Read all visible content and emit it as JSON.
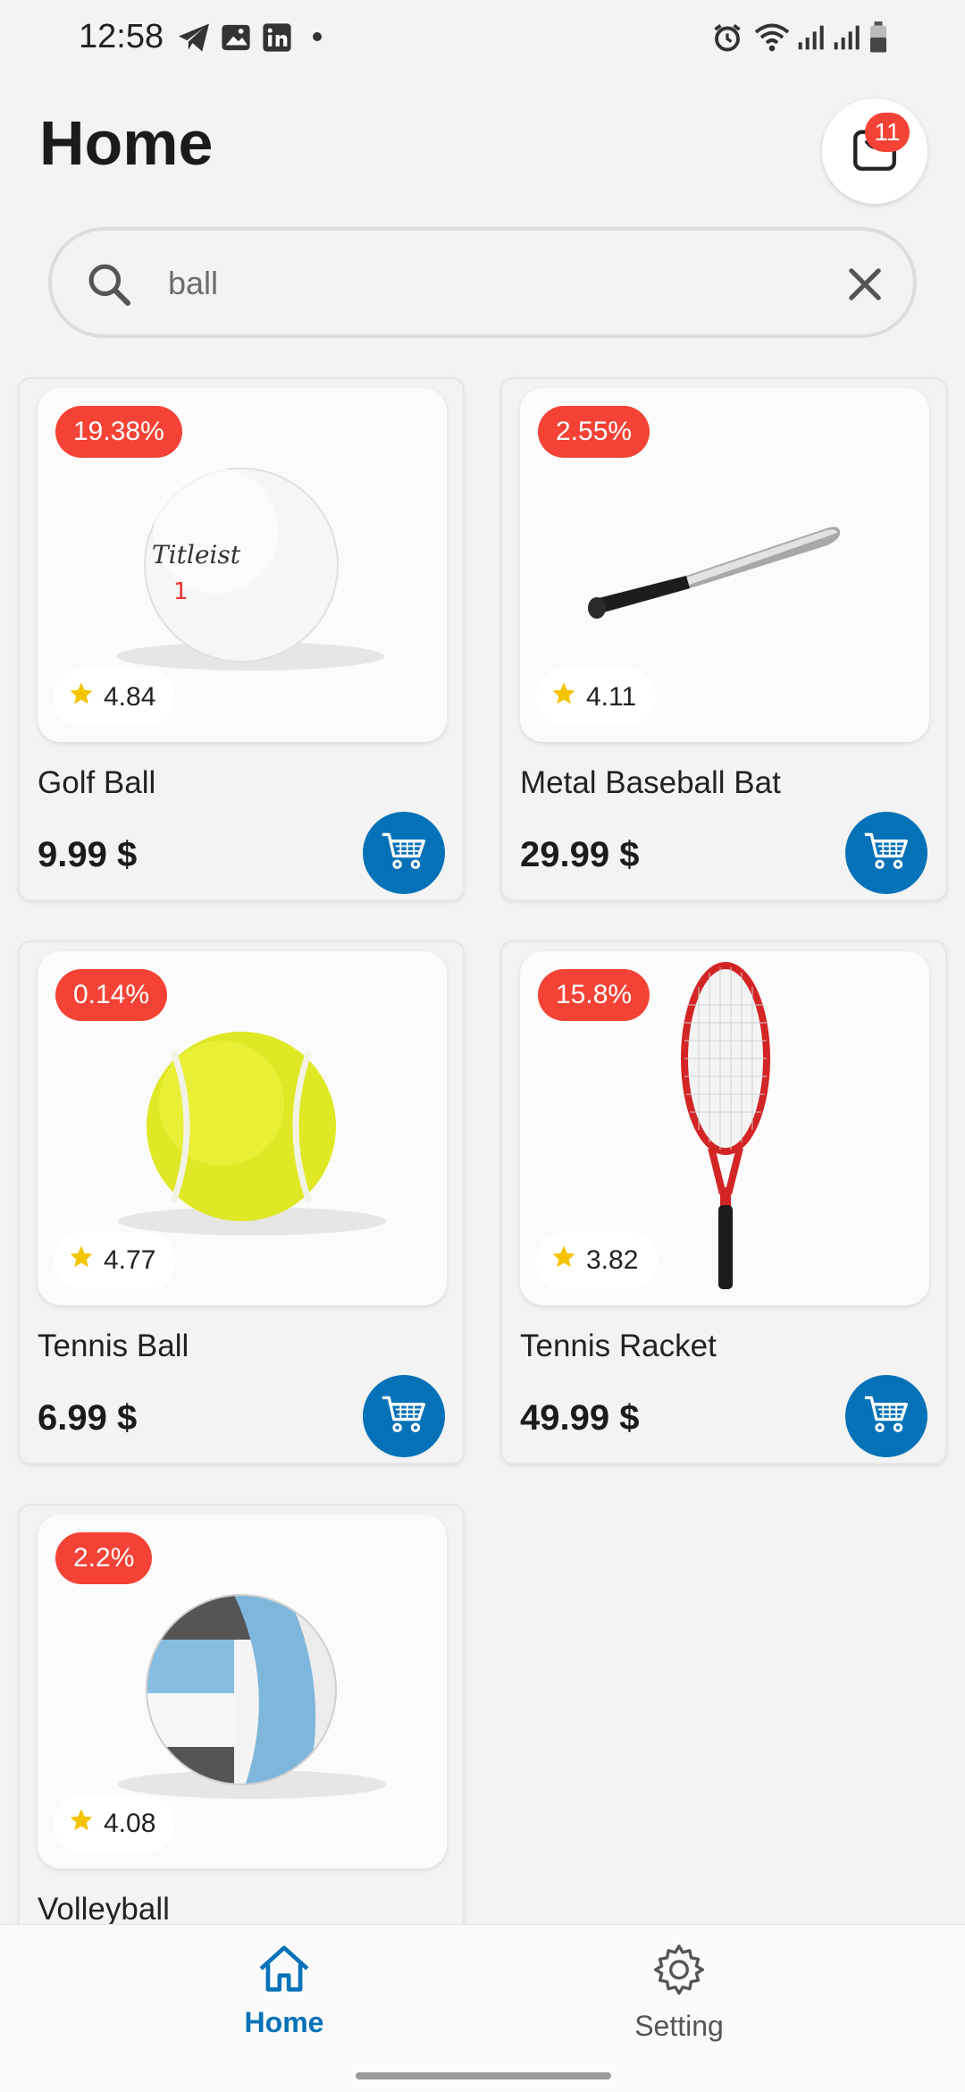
{
  "status_bar": {
    "time": "12:58",
    "left_icons": [
      "telegram-icon",
      "gallery-icon",
      "linkedin-icon",
      "dot-icon"
    ],
    "right_icons": [
      "alarm-icon",
      "wifi-icon",
      "signal-icon",
      "signal-icon",
      "battery-icon"
    ]
  },
  "header": {
    "title": "Home",
    "cart_badge": "11"
  },
  "search": {
    "value": "ball",
    "placeholder": ""
  },
  "products": [
    {
      "discount": "19.38%",
      "rating": "4.84",
      "name": "Golf Ball",
      "price": "9.99 $",
      "image": "golf-ball"
    },
    {
      "discount": "2.55%",
      "rating": "4.11",
      "name": "Metal Baseball Bat",
      "price": "29.99 $",
      "image": "baseball-bat"
    },
    {
      "discount": "0.14%",
      "rating": "4.77",
      "name": "Tennis Ball",
      "price": "6.99 $",
      "image": "tennis-ball"
    },
    {
      "discount": "15.8%",
      "rating": "3.82",
      "name": "Tennis Racket",
      "price": "49.99 $",
      "image": "tennis-racket"
    },
    {
      "discount": "2.2%",
      "rating": "4.08",
      "name": "Volleyball",
      "price": "",
      "image": "volleyball"
    }
  ],
  "bottom_nav": {
    "items": [
      {
        "label": "Home",
        "icon": "home-icon",
        "active": true
      },
      {
        "label": "Setting",
        "icon": "gear-icon",
        "active": false
      }
    ]
  },
  "colors": {
    "accent": "#0572b8",
    "badge": "#f44336",
    "background": "#f3f3f3",
    "star": "#f5c400"
  }
}
